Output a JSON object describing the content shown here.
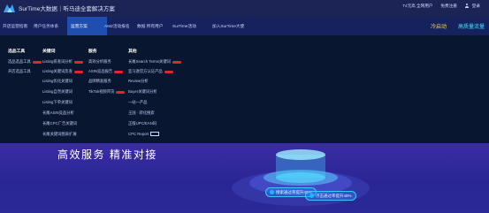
{
  "header": {
    "site_title": "SurTime大数据｜听马迪全套解决方案",
    "links": [
      "T4元高 全网用户",
      "免费注册",
      "登录"
    ]
  },
  "nav": {
    "items": [
      "开店运营指南",
      "用户任务体系",
      "运营方案",
      "AMZ活动报名",
      "数据 所有用户",
      "SurTime活动",
      "加入SurTime大使"
    ],
    "cta_primary": "冷启动",
    "cta_secondary": "高质量流量"
  },
  "menu": {
    "col1": {
      "title": "选品工具",
      "items": [
        "选品选品工具",
        "开店选品工具"
      ]
    },
    "col2": {
      "title": "关键词",
      "items": [
        "Listing排查词分析",
        "Listing关键词反查",
        "Listing优化关键词",
        "Listing自然关键词",
        "Listing下单关键词",
        "长尾ASIN竞品分析",
        "长尾CPC广告关键词",
        "长尾关键词图表扩展"
      ]
    },
    "col3": {
      "title": "服务",
      "items": [
        "高效分析服务",
        "ASIN竞品报告",
        "品牌精准服务",
        "TikTok视频带货"
      ]
    },
    "col4": {
      "title": "其他",
      "items": [
        "长尾Search Terms关键词",
        "亚马逊官方认证产品",
        "Review分析",
        "Buyer关键词分析",
        "一站一产品",
        "王国 · 转化搜索",
        "正版UPC/EAN码",
        "CPC Report"
      ]
    }
  },
  "banner": {
    "slogan": "高效服务 精准对接",
    "pill_1": "搜索通过率提升48%",
    "pill_2": "点击通过率提升48%"
  },
  "colors": {
    "accent_red": "#e8232b",
    "nav_active": "#1e4fb0",
    "cta_yellow": "#ffd84a",
    "cta_cyan": "#3ee0ff"
  }
}
